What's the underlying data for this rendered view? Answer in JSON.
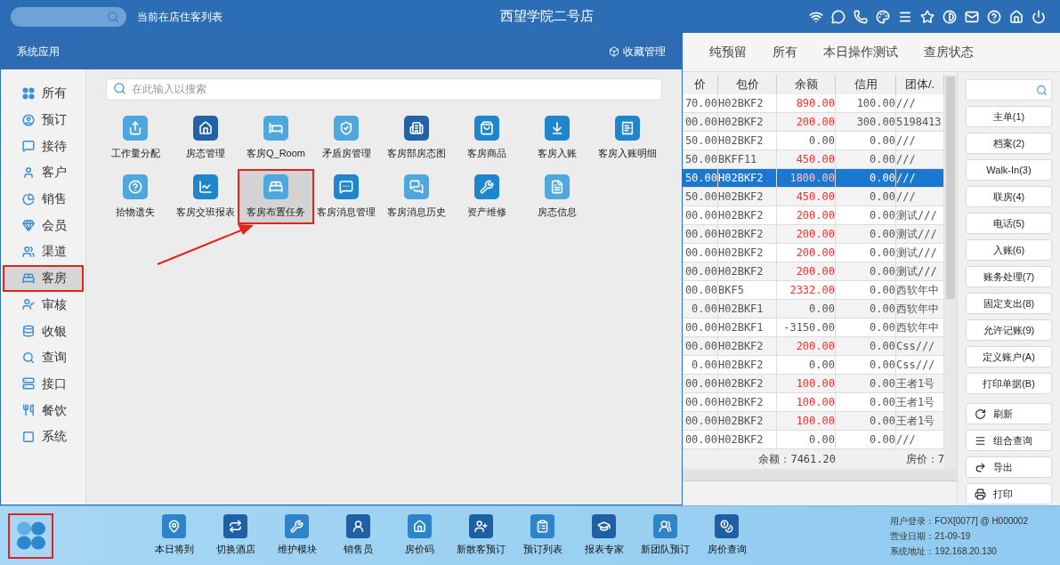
{
  "top_bar": {
    "subtitle": "当前在店住客列表",
    "title": "西望学院二号店"
  },
  "tabs": [
    {
      "label": "纯预留",
      "selected": false
    },
    {
      "label": "所有",
      "selected": false
    },
    {
      "label": "本日操作测试",
      "selected": false
    },
    {
      "label": "查房状态",
      "selected": false
    }
  ],
  "app_panel": {
    "title": "系统应用",
    "favorites": "收藏管理",
    "search_placeholder": "在此输入以搜索",
    "categories": [
      {
        "label": "所有",
        "selected": false,
        "annotated": false
      },
      {
        "label": "预订",
        "selected": false,
        "annotated": false
      },
      {
        "label": "接待",
        "selected": false,
        "annotated": false
      },
      {
        "label": "客户",
        "selected": false,
        "annotated": false
      },
      {
        "label": "销售",
        "selected": false,
        "annotated": false
      },
      {
        "label": "会员",
        "selected": false,
        "annotated": false
      },
      {
        "label": "渠道",
        "selected": false,
        "annotated": false
      },
      {
        "label": "客房",
        "selected": true,
        "annotated": true
      },
      {
        "label": "审核",
        "selected": false,
        "annotated": false
      },
      {
        "label": "收银",
        "selected": false,
        "annotated": false
      },
      {
        "label": "查询",
        "selected": false,
        "annotated": false
      },
      {
        "label": "接口",
        "selected": false,
        "annotated": false
      },
      {
        "label": "餐饮",
        "selected": false,
        "annotated": false
      },
      {
        "label": "系统",
        "selected": false,
        "annotated": false
      }
    ],
    "apps": [
      {
        "label": "工作量分配",
        "color": "#4ea8de",
        "selected": false,
        "annotated": false
      },
      {
        "label": "房态管理",
        "color": "#2462a8",
        "selected": false,
        "annotated": false
      },
      {
        "label": "客房Q_Room",
        "color": "#4ea8de",
        "selected": false,
        "annotated": false
      },
      {
        "label": "矛盾房管理",
        "color": "#4ea8de",
        "selected": false,
        "annotated": false
      },
      {
        "label": "客房部房态图",
        "color": "#2462a8",
        "selected": false,
        "annotated": false
      },
      {
        "label": "客房商品",
        "color": "#1f86cc",
        "selected": false,
        "annotated": false
      },
      {
        "label": "客房入账",
        "color": "#1f86cc",
        "selected": false,
        "annotated": false
      },
      {
        "label": "客房入账明细",
        "color": "#1f86cc",
        "selected": false,
        "annotated": false
      },
      {
        "label": "拾物遗失",
        "color": "#4ea8de",
        "selected": false,
        "annotated": false
      },
      {
        "label": "客房交班报表",
        "color": "#1f86cc",
        "selected": false,
        "annotated": false
      },
      {
        "label": "客房布置任务",
        "color": "#4ea8de",
        "selected": true,
        "annotated": true
      },
      {
        "label": "客房消息管理",
        "color": "#1f86cc",
        "selected": false,
        "annotated": false
      },
      {
        "label": "客房消息历史",
        "color": "#4ea8de",
        "selected": false,
        "annotated": false
      },
      {
        "label": "资产维修",
        "color": "#1f86cc",
        "selected": false,
        "annotated": false
      },
      {
        "label": "房态信息",
        "color": "#4ea8de",
        "selected": false,
        "annotated": false
      }
    ]
  },
  "table": {
    "columns": [
      "价",
      "包价",
      "余额",
      "信用",
      "团体/."
    ],
    "rows": [
      {
        "cells": [
          "70.00",
          "H02BKF2",
          "890.00",
          "100.00",
          "///"
        ],
        "selected": false,
        "owed": true
      },
      {
        "cells": [
          "00.00",
          "H02BKF2",
          "200.00",
          "300.00",
          "5198413"
        ],
        "selected": false,
        "owed": true
      },
      {
        "cells": [
          "50.00",
          "H02BKF2",
          "0.00",
          "0.00",
          "///"
        ],
        "selected": false,
        "owed": false
      },
      {
        "cells": [
          "50.00",
          "BKFF11",
          "450.00",
          "0.00",
          "///"
        ],
        "selected": false,
        "owed": true
      },
      {
        "cells": [
          "50.00",
          "H02BKF2",
          "1800.00",
          "0.00",
          "///"
        ],
        "selected": true,
        "owed": true
      },
      {
        "cells": [
          "50.00",
          "H02BKF2",
          "450.00",
          "0.00",
          "///"
        ],
        "selected": false,
        "owed": true
      },
      {
        "cells": [
          "00.00",
          "H02BKF2",
          "200.00",
          "0.00",
          "测试///"
        ],
        "selected": false,
        "owed": true
      },
      {
        "cells": [
          "00.00",
          "H02BKF2",
          "200.00",
          "0.00",
          "测试///"
        ],
        "selected": false,
        "owed": true
      },
      {
        "cells": [
          "00.00",
          "H02BKF2",
          "200.00",
          "0.00",
          "测试///"
        ],
        "selected": false,
        "owed": true
      },
      {
        "cells": [
          "00.00",
          "H02BKF2",
          "200.00",
          "0.00",
          "测试///"
        ],
        "selected": false,
        "owed": true
      },
      {
        "cells": [
          "00.00",
          "BKF5",
          "2332.00",
          "0.00",
          "西软年中"
        ],
        "selected": false,
        "owed": true
      },
      {
        "cells": [
          "0.00",
          "H02BKF1",
          "0.00",
          "0.00",
          "西软年中"
        ],
        "selected": false,
        "owed": false
      },
      {
        "cells": [
          "00.00",
          "H02BKF1",
          "-3150.00",
          "0.00",
          "西软年中"
        ],
        "selected": false,
        "owed": false
      },
      {
        "cells": [
          "00.00",
          "H02BKF2",
          "200.00",
          "0.00",
          "Css///"
        ],
        "selected": false,
        "owed": true
      },
      {
        "cells": [
          "0.00",
          "H02BKF2",
          "0.00",
          "0.00",
          "Css///"
        ],
        "selected": false,
        "owed": false
      },
      {
        "cells": [
          "00.00",
          "H02BKF2",
          "100.00",
          "0.00",
          "王者1号"
        ],
        "selected": false,
        "owed": true
      },
      {
        "cells": [
          "00.00",
          "H02BKF2",
          "100.00",
          "0.00",
          "王者1号"
        ],
        "selected": false,
        "owed": true
      },
      {
        "cells": [
          "00.00",
          "H02BKF2",
          "100.00",
          "0.00",
          "王者1号"
        ],
        "selected": false,
        "owed": true
      },
      {
        "cells": [
          "00.00",
          "H02BKF2",
          "0.00",
          "0.00",
          "///"
        ],
        "selected": false,
        "owed": false
      }
    ],
    "footer": [
      "余额：7461.20",
      "房价：7"
    ]
  },
  "actions": [
    {
      "label": "主单(1)",
      "kind": "plain"
    },
    {
      "label": "档案(2)",
      "kind": "plain"
    },
    {
      "label": "Walk-In(3)",
      "kind": "plain"
    },
    {
      "label": "联房(4)",
      "kind": "plain"
    },
    {
      "label": "电话(5)",
      "kind": "plain"
    },
    {
      "label": "入账(6)",
      "kind": "plain"
    },
    {
      "label": "账务处理(7)",
      "kind": "plain"
    },
    {
      "label": "固定支出(8)",
      "kind": "plain"
    },
    {
      "label": "允许记账(9)",
      "kind": "plain"
    },
    {
      "label": "定义账户(A)",
      "kind": "plain"
    },
    {
      "label": "打印单据(B)",
      "kind": "plain"
    },
    {
      "label": "刷新",
      "kind": "refresh"
    },
    {
      "label": "组合查询",
      "kind": "query"
    },
    {
      "label": "导出",
      "kind": "export"
    },
    {
      "label": "打印",
      "kind": "print"
    }
  ],
  "dock": {
    "logo_annotated": true,
    "items": [
      "本日将到",
      "切换酒店",
      "维护模块",
      "销售员",
      "房价码",
      "新散客预订",
      "预订列表",
      "报表专家",
      "新团队预订",
      "房价查询"
    ],
    "info": [
      "用户登录：FOX[0077] @ H000002",
      "营业日期：21-09-19",
      "系统地址：192.168.20.130"
    ]
  }
}
